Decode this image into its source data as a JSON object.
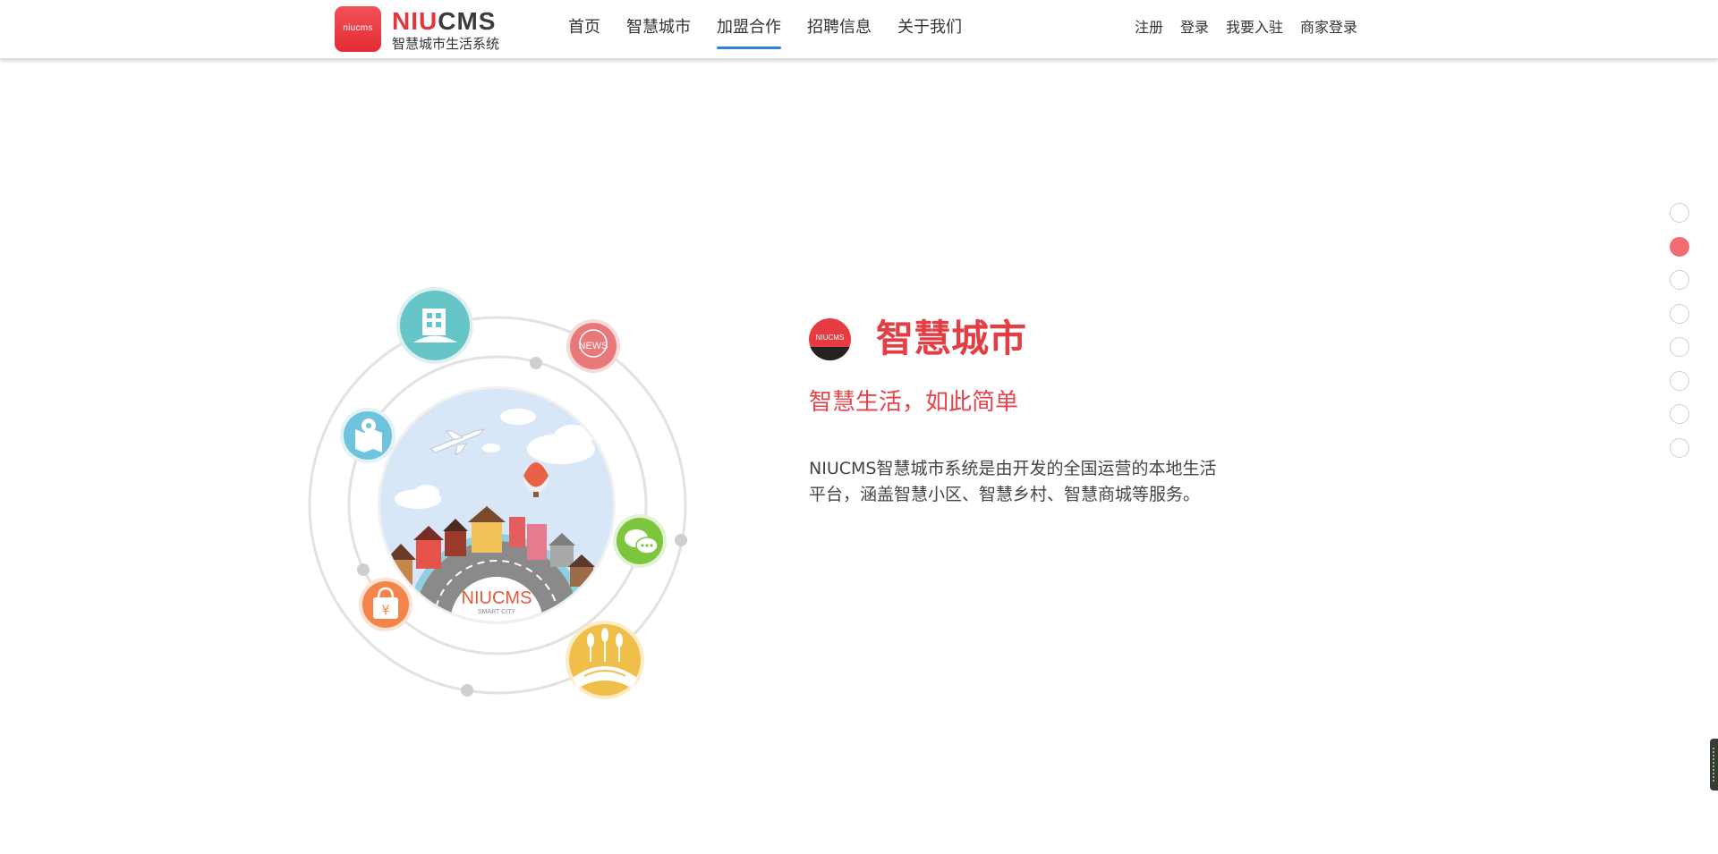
{
  "header": {
    "logo": {
      "icon_text": "niucms",
      "brand_part1": "NIU",
      "brand_part2": "CMS",
      "subtitle": "智慧城市生活系统"
    },
    "nav": [
      {
        "label": "首页",
        "active": false
      },
      {
        "label": "智慧城市",
        "active": false
      },
      {
        "label": "加盟合作",
        "active": true
      },
      {
        "label": "招聘信息",
        "active": false
      },
      {
        "label": "关于我们",
        "active": false
      }
    ],
    "user_links": [
      {
        "label": "注册"
      },
      {
        "label": "登录"
      },
      {
        "label": "我要入驻"
      },
      {
        "label": "商家登录"
      }
    ]
  },
  "illustration": {
    "badge_title": "NIUCMS",
    "badge_sub": "SMART CITY",
    "news_label": "NEWS",
    "currency_symbol": "¥",
    "icons": [
      "building-icon",
      "news-icon",
      "map-icon",
      "chat-icon",
      "shopping-bag-icon",
      "farm-icon"
    ]
  },
  "section": {
    "logo_text": "NIUCMS",
    "title": "智慧城市",
    "subtitle": "智慧生活，如此简单",
    "description": "NIUCMS智慧城市系统是由开发的全国运营的本地生活平台，涵盖智慧小区、智慧乡村、智慧商城等服务。"
  },
  "pager": {
    "count": 8,
    "active_index": 1
  },
  "colors": {
    "brand_red": "#e43e45",
    "nav_active_underline": "#2b84dc",
    "pager_active": "#f36c71"
  }
}
